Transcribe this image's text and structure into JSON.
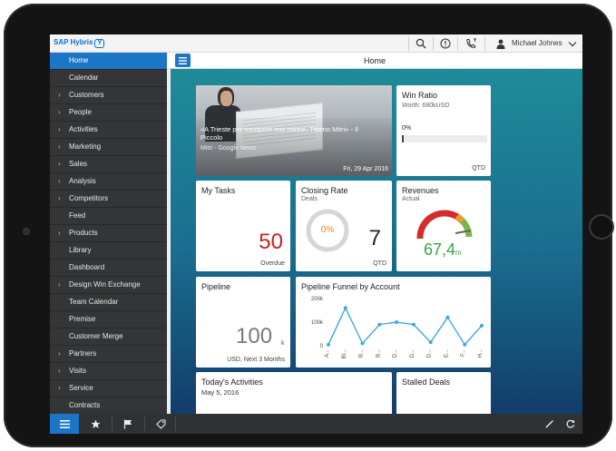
{
  "shell": {
    "logo_text": "SAP Hybris",
    "logo_mark": "Y",
    "user_name": "Michael Johnes"
  },
  "sidebar": {
    "items": [
      {
        "label": "Home",
        "expandable": false,
        "active": true
      },
      {
        "label": "Calendar",
        "expandable": false
      },
      {
        "label": "Customers",
        "expandable": true
      },
      {
        "label": "People",
        "expandable": true
      },
      {
        "label": "Activities",
        "expandable": true
      },
      {
        "label": "Marketing",
        "expandable": true
      },
      {
        "label": "Sales",
        "expandable": true
      },
      {
        "label": "Analysis",
        "expandable": true
      },
      {
        "label": "Competitors",
        "expandable": true
      },
      {
        "label": "Feed",
        "expandable": false
      },
      {
        "label": "Products",
        "expandable": true
      },
      {
        "label": "Library",
        "expandable": false
      },
      {
        "label": "Dashboard",
        "expandable": false
      },
      {
        "label": "Design Win Exchange",
        "expandable": true
      },
      {
        "label": "Team Calendar",
        "expandable": false
      },
      {
        "label": "Premise",
        "expandable": false
      },
      {
        "label": "Customer Merge",
        "expandable": false
      },
      {
        "label": "Partners",
        "expandable": true
      },
      {
        "label": "Visits",
        "expandable": true
      },
      {
        "label": "Service",
        "expandable": true
      },
      {
        "label": "Contracts",
        "expandable": false
      }
    ]
  },
  "main": {
    "title": "Home"
  },
  "tiles": {
    "news": {
      "headline": "«A Trieste per riscoprire mio nonno, Tiberio Mitri» - Il Piccolo",
      "source": "Mitri - Google News",
      "date": "Fri, 29 Apr 2016"
    },
    "win_ratio": {
      "title": "Win Ratio",
      "subtitle": "Worth: 680kUSD",
      "value": "0%",
      "progress": 0,
      "footer": "QTD"
    },
    "my_tasks": {
      "title": "My Tasks",
      "value": "50",
      "footer": "Overdue",
      "value_color": "#cc1f1f"
    },
    "closing_rate": {
      "title": "Closing Rate",
      "subtitle": "Deals",
      "percent_label": "0%",
      "value": "7",
      "footer": "QTD",
      "accent_color": "#e8832a"
    },
    "revenues": {
      "title": "Revenues",
      "subtitle": "Actual",
      "value": "67,4",
      "unit": "m",
      "value_color": "#3fa046"
    },
    "pipeline": {
      "title": "Pipeline",
      "value": "100",
      "unit": "k",
      "footer": "USD, Next 3 Months"
    },
    "pipeline_funnel": {
      "title": "Pipeline Funnel by Account"
    },
    "todays_activities": {
      "title": "Today's Activities",
      "date": "May 5, 2016"
    },
    "stalled_deals": {
      "title": "Stalled Deals"
    }
  },
  "chart_data": {
    "type": "line",
    "title": "Pipeline Funnel by Account",
    "categories": [
      "A...",
      "Bl...",
      "B...",
      "B...",
      "D...",
      "D...",
      "D...",
      "E...",
      "F...",
      "H..."
    ],
    "series": [
      {
        "values": [
          5000,
          160000,
          10000,
          90000,
          100000,
          90000,
          15000,
          120000,
          5000,
          85000
        ]
      }
    ],
    "yticks": [
      "200k",
      "100k",
      "0"
    ],
    "ylim": [
      0,
      200000
    ],
    "grid": false,
    "line_color": "#3fa9e0"
  },
  "icons": {
    "search": "search-icon",
    "info": "info-icon",
    "phone": "phone-icon",
    "user": "user-icon",
    "dropdown": "chevron-down-icon"
  }
}
